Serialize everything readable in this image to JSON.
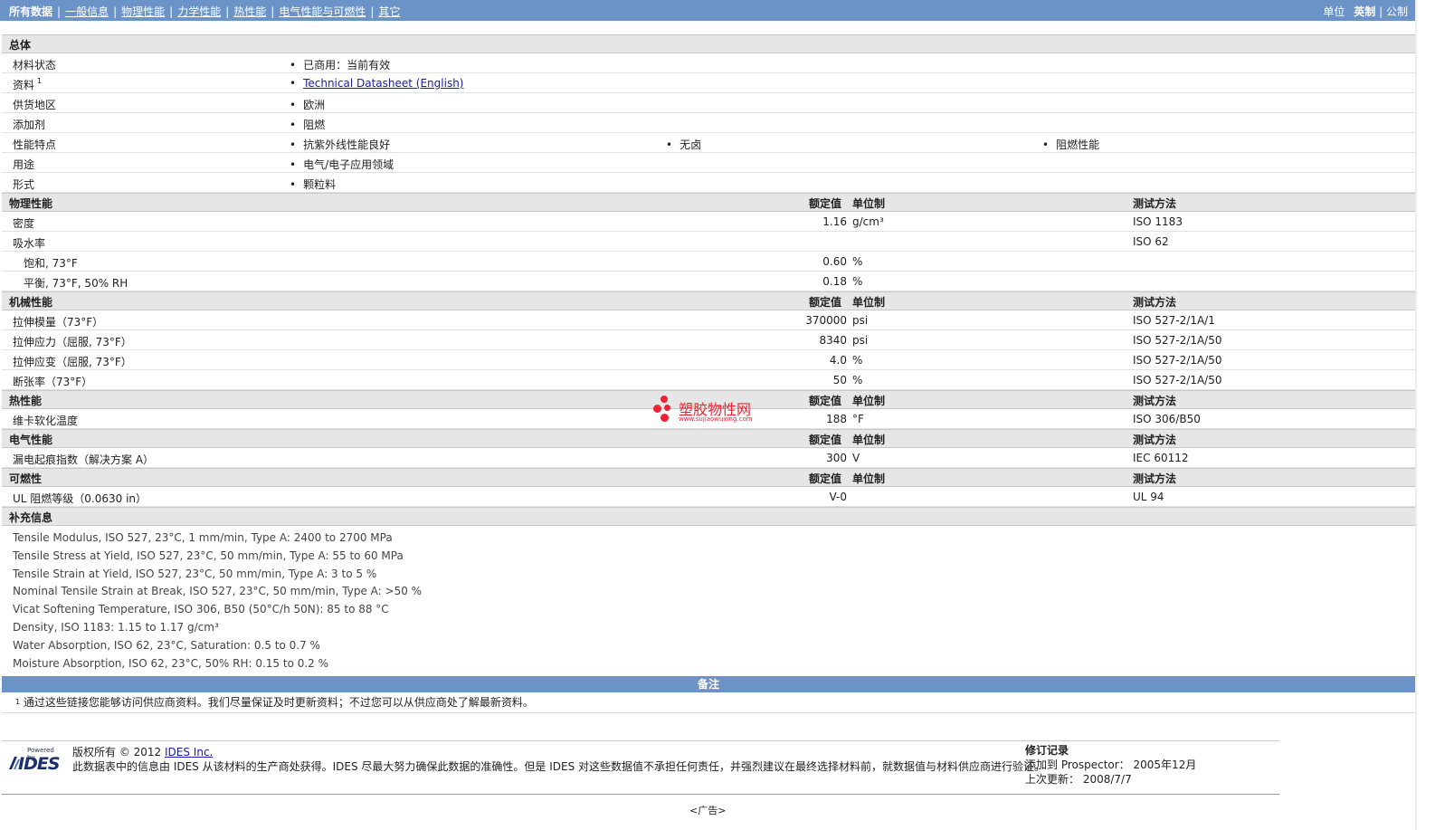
{
  "nav": {
    "active": "所有数据",
    "links": [
      "一般信息",
      "物理性能",
      "力学性能",
      "热性能",
      "电气性能与可燃性",
      "其它"
    ]
  },
  "units": {
    "label": "单位",
    "current": "英制",
    "alt": "公制"
  },
  "general": {
    "title": "总体",
    "rows": [
      {
        "label": "材料状态",
        "values": [
          "已商用：当前有效"
        ]
      },
      {
        "label": "资料",
        "sup": "1",
        "link": "Technical Datasheet (English)"
      },
      {
        "label": "供货地区",
        "values": [
          "欧洲"
        ]
      },
      {
        "label": "添加剂",
        "values": [
          "阻燃"
        ]
      },
      {
        "label": "性能特点",
        "values": [
          "抗紫外线性能良好",
          "无卤",
          "阻燃性能"
        ]
      },
      {
        "label": "用途",
        "values": [
          "电气/电子应用领域"
        ]
      },
      {
        "label": "形式",
        "values": [
          "颗粒料"
        ]
      }
    ]
  },
  "headers": {
    "nominal": "额定值",
    "unit": "单位制",
    "method": "测试方法"
  },
  "physical": {
    "title": "物理性能",
    "rows": [
      {
        "label": "密度",
        "value": "1.16",
        "unit": "g/cm³",
        "method": "ISO 1183"
      },
      {
        "label": "吸水率",
        "value": "",
        "unit": "",
        "method": "ISO 62"
      },
      {
        "label": "饱和, 73°F",
        "value": "0.60",
        "unit": "%",
        "method": "",
        "indent": true
      },
      {
        "label": "平衡, 73°F, 50% RH",
        "value": "0.18",
        "unit": "%",
        "method": "",
        "indent": true
      }
    ]
  },
  "mechanical": {
    "title": "机械性能",
    "rows": [
      {
        "label": "拉伸模量（73°F）",
        "value": "370000",
        "unit": "psi",
        "method": "ISO 527-2/1A/1"
      },
      {
        "label": "拉伸应力（屈服, 73°F）",
        "value": "8340",
        "unit": "psi",
        "method": "ISO 527-2/1A/50"
      },
      {
        "label": "拉伸应变（屈服, 73°F）",
        "value": "4.0",
        "unit": "%",
        "method": "ISO 527-2/1A/50"
      },
      {
        "label": "断张率（73°F）",
        "value": "50",
        "unit": "%",
        "method": "ISO 527-2/1A/50"
      }
    ]
  },
  "thermal": {
    "title": "热性能",
    "rows": [
      {
        "label": "维卡软化温度",
        "value": "188",
        "unit": "°F",
        "method": "ISO 306/B50"
      }
    ]
  },
  "electrical": {
    "title": "电气性能",
    "rows": [
      {
        "label": "漏电起痕指数（解决方案 A）",
        "value": "300",
        "unit": "V",
        "method": "IEC 60112"
      }
    ]
  },
  "flammability": {
    "title": "可燃性",
    "rows": [
      {
        "label": "UL 阻燃等级（0.0630 in）",
        "value": "V-0",
        "unit": "",
        "method": "UL 94"
      }
    ]
  },
  "supplemental": {
    "title": "补充信息",
    "lines": [
      "Tensile Modulus, ISO 527, 23°C, 1 mm/min, Type A: 2400 to 2700 MPa",
      "Tensile Stress at Yield, ISO 527, 23°C, 50 mm/min, Type A: 55 to 60 MPa",
      "Tensile Strain at Yield, ISO 527, 23°C, 50 mm/min, Type A: 3 to 5 %",
      "Nominal Tensile Strain at Break, ISO 527, 23°C, 50 mm/min, Type A: >50 %",
      "Vicat Softening Temperature, ISO 306, B50 (50°C/h 50N): 85 to 88 °C",
      "Density, ISO 1183: 1.15 to 1.17 g/cm³",
      "Water Absorption, ISO 62, 23°C, Saturation: 0.5 to 0.7 %",
      "Moisture Absorption, ISO 62, 23°C, 50% RH: 0.15 to 0.2 %"
    ]
  },
  "notes": {
    "title": "备注",
    "sup": "1",
    "text": "通过这些链接您能够访问供应商资料。我们尽量保证及时更新资料；不过您可以从供应商处了解最新资料。"
  },
  "footer": {
    "logo_powered": "Powered by",
    "logo_name": "IDES",
    "copyright_prefix": "版权所有 © 2012",
    "copyright_link": "IDES Inc.",
    "disclaimer": "此数据表中的信息由 IDES 从该材料的生产商处获得。IDES 尽最大努力确保此数据的准确性。但是 IDES 对这些数据值不承担任何责任，并强烈建议在最终选择材料前，就数据值与材料供应商进行验证。",
    "revision_title": "修订记录",
    "added_label": "添加到 Prospector：",
    "added_value": "2005年12月",
    "updated_label": "上次更新：",
    "updated_value": "2008/7/7"
  },
  "ad": "<广告>",
  "watermark": {
    "name": "塑胶物性网",
    "url": "www.sujiaowuxing.com"
  }
}
